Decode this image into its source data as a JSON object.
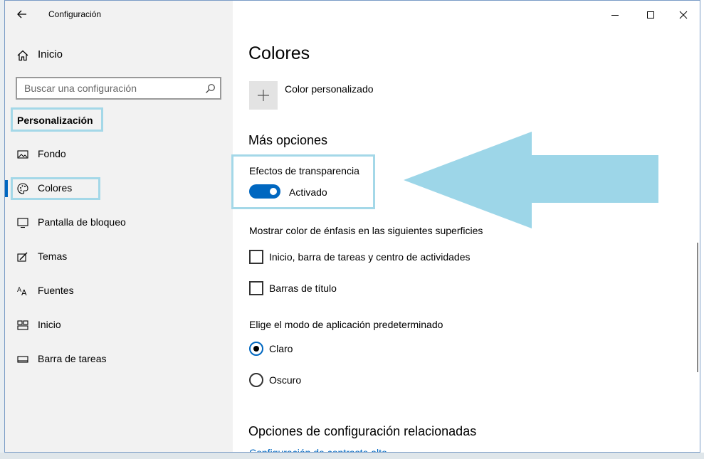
{
  "window": {
    "title": "Configuración"
  },
  "nav": {
    "home_label": "Inicio",
    "search_placeholder": "Buscar una configuración",
    "section_title": "Personalización",
    "items": [
      {
        "label": "Fondo",
        "icon": "picture-icon"
      },
      {
        "label": "Colores",
        "icon": "palette-icon",
        "selected": true
      },
      {
        "label": "Pantalla de bloqueo",
        "icon": "lock-screen-icon"
      },
      {
        "label": "Temas",
        "icon": "brush-icon"
      },
      {
        "label": "Fuentes",
        "icon": "font-icon"
      },
      {
        "label": "Inicio",
        "icon": "start-layout-icon"
      },
      {
        "label": "Barra de tareas",
        "icon": "taskbar-icon"
      }
    ]
  },
  "content": {
    "title": "Colores",
    "custom_color_label": "Color personalizado",
    "more_options_title": "Más opciones",
    "transparency": {
      "label": "Efectos de transparencia",
      "state_label": "Activado",
      "on": true
    },
    "accent_surfaces": {
      "label": "Mostrar color de énfasis en las siguientes superficies",
      "options": [
        {
          "label": "Inicio, barra de tareas y centro de actividades",
          "checked": false
        },
        {
          "label": "Barras de título",
          "checked": false
        }
      ]
    },
    "app_mode": {
      "label": "Elige el modo de aplicación predeterminado",
      "options": [
        {
          "label": "Claro",
          "selected": true
        },
        {
          "label": "Oscuro",
          "selected": false
        }
      ]
    },
    "related_title": "Opciones de configuración relacionadas",
    "related_link": "Configuración de contraste alto"
  },
  "colors": {
    "accent": "#0067c0",
    "highlight_annotation": "#a4d8e8",
    "arrow_annotation": "#9dd6e8",
    "nav_background": "#f2f2f2"
  }
}
